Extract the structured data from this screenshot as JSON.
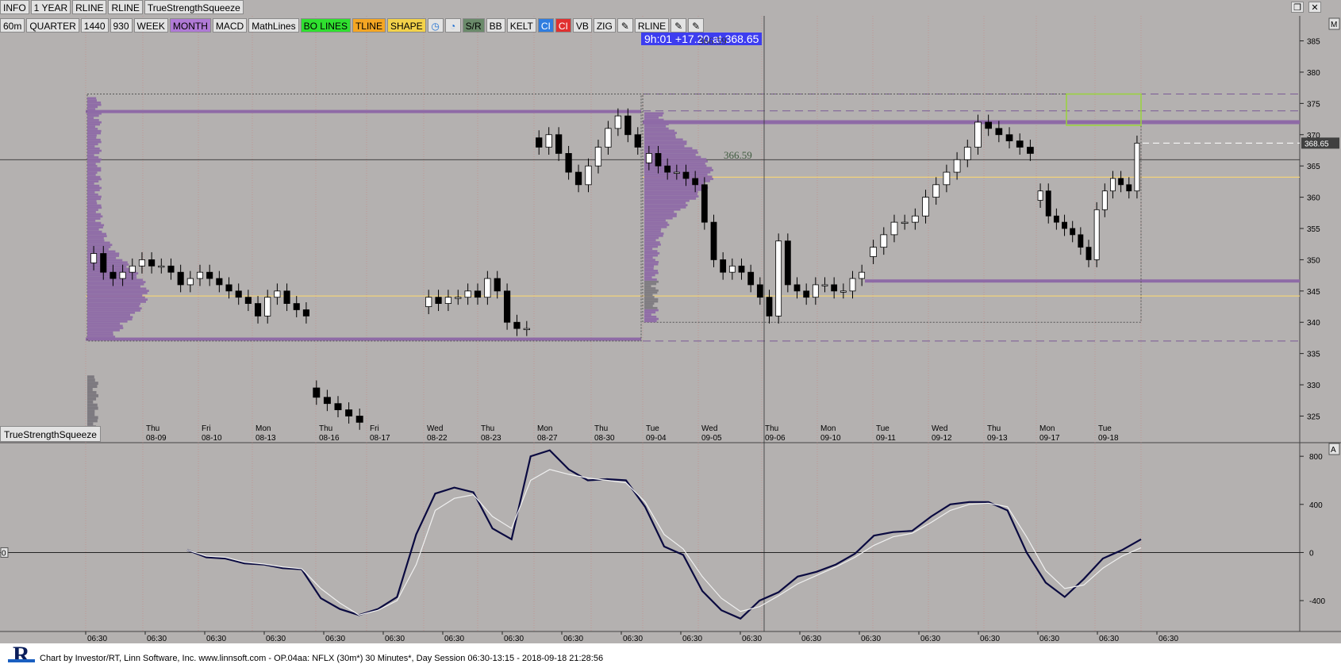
{
  "toolbar_row1": [
    "INFO",
    "1 YEAR",
    "RLINE",
    "RLINE",
    "TrueStrengthSqueeze"
  ],
  "toolbar_row2": [
    {
      "label": "60m",
      "color": "#e3e3e3"
    },
    {
      "label": "QUARTER",
      "color": "#e3e3e3"
    },
    {
      "label": "1440",
      "color": "#e3e3e3"
    },
    {
      "label": "930",
      "color": "#e3e3e3"
    },
    {
      "label": "WEEK",
      "color": "#e3e3e3"
    },
    {
      "label": "MONTH",
      "color": "#b07ad6"
    },
    {
      "label": "MACD",
      "color": "#e3e3e3"
    },
    {
      "label": "MathLines",
      "color": "#e3e3e3"
    },
    {
      "label": "BO LINES",
      "color": "#2fe02f"
    },
    {
      "label": "TLINE",
      "color": "#f5a623"
    },
    {
      "label": "SHAPE",
      "color": "#f3d24a"
    },
    {
      "icon": "clock-icon",
      "glyph": "◷",
      "color": "#e3e3e3"
    },
    {
      "icon": "stopwatch-icon",
      "glyph": "◔",
      "color": "#e3e3e3"
    },
    {
      "label": "S/R",
      "color": "#6a8a6a"
    },
    {
      "label": "BB",
      "color": "#e3e3e3"
    },
    {
      "label": "KELT",
      "color": "#e3e3e3"
    },
    {
      "label": "CI",
      "color": "#2f7de0"
    },
    {
      "label": "CI",
      "color": "#e03030"
    },
    {
      "label": "VB",
      "color": "#e3e3e3"
    },
    {
      "label": "ZIG",
      "color": "#e3e3e3"
    },
    {
      "icon": "pencil-icon",
      "glyph": "✎",
      "color": "#e3e3e3"
    },
    {
      "label": "RLINE",
      "color": "#e3e3e3"
    },
    {
      "icon": "pencil-icon",
      "glyph": "✎",
      "color": "#e3e3e3"
    },
    {
      "icon": "pencil-icon",
      "glyph": "✎",
      "color": "#e3e3e3"
    }
  ],
  "price_info": "9h:01  +17.20 at 368.65",
  "price_info_overlay": "366.59",
  "vpoc_label": "366.59",
  "indicator_label": "TrueStrengthSqueeze",
  "last_price_tag": "368.65",
  "zero_marker": "0",
  "right_markers": {
    "main": "M",
    "indicator": "A"
  },
  "footer_text": "Chart by Investor/RT, Linn Software, Inc. www.linnsoft.com - OP.04aa: NFLX (30m*) 30 Minutes*, Day Session 06:30-13:15 - 2018-09-18 21:28:56",
  "chart_data": [
    {
      "type": "candlestick",
      "title": "NFLX (30m*) 30 Minutes*",
      "ylim": [
        321,
        389
      ],
      "y_ticks": [
        325,
        330,
        335,
        340,
        345,
        350,
        355,
        360,
        365,
        370,
        375,
        380,
        385
      ],
      "day_labels": [
        {
          "day": "Thu",
          "date": "08-09"
        },
        {
          "day": "Fri",
          "date": "08-10"
        },
        {
          "day": "Mon",
          "date": "08-13"
        },
        {
          "day": "Thu",
          "date": "08-16"
        },
        {
          "day": "Fri",
          "date": "08-17"
        },
        {
          "day": "Wed",
          "date": "08-22"
        },
        {
          "day": "Thu",
          "date": "08-23"
        },
        {
          "day": "Mon",
          "date": "08-27"
        },
        {
          "day": "Thu",
          "date": "08-30"
        },
        {
          "day": "Tue",
          "date": "09-04"
        },
        {
          "day": "Wed",
          "date": "09-05"
        },
        {
          "day": "Thu",
          "date": "09-06"
        },
        {
          "day": "Mon",
          "date": "09-10"
        },
        {
          "day": "Tue",
          "date": "09-11"
        },
        {
          "day": "Wed",
          "date": "09-12"
        },
        {
          "day": "Thu",
          "date": "09-13"
        },
        {
          "day": "Mon",
          "date": "09-17"
        },
        {
          "day": "Tue",
          "date": "09-18"
        }
      ],
      "closes": [
        351,
        348,
        347,
        348,
        349,
        350,
        349,
        349,
        348,
        346,
        347,
        348,
        347,
        346,
        345,
        344,
        343,
        341,
        344,
        345,
        343,
        342,
        341,
        328,
        327,
        326,
        325,
        324,
        344,
        343,
        344,
        344,
        345,
        344,
        347,
        345,
        340,
        339,
        339,
        368,
        370,
        367,
        364,
        362,
        365,
        368,
        371,
        373,
        370,
        368,
        367,
        365,
        364,
        364,
        363,
        362,
        356,
        350,
        348,
        349,
        348,
        346,
        344,
        341,
        353,
        346,
        345,
        344,
        346,
        346,
        345,
        345,
        347,
        348,
        352,
        354,
        356,
        356,
        357,
        360,
        362,
        364,
        366,
        368,
        372,
        371,
        370,
        369,
        368,
        367,
        361,
        357,
        356,
        355,
        354,
        352,
        350,
        358,
        361,
        363,
        362,
        361,
        368.65
      ],
      "reference_lines": {
        "value_area_high_aug": 373.7,
        "poc_aug": 344.2,
        "value_area_low_aug": 337.3,
        "value_area_high_sep": 372.0,
        "poc_sep": 363.2,
        "value_area_low_sep": 346.6,
        "dashed_upper": 376.5,
        "dashed_mid": 373.8,
        "dashed_lower": 337.0,
        "current": 366.0
      }
    },
    {
      "type": "line",
      "title": "TrueStrengthSqueeze",
      "ylim": [
        -650,
        900
      ],
      "y_ticks": [
        -400,
        0,
        400,
        800
      ],
      "x_labels": [
        "06:30",
        "06:30",
        "06:30",
        "06:30",
        "06:30",
        "06:30",
        "06:30",
        "06:30",
        "06:30",
        "06:30",
        "06:30",
        "06:30",
        "06:30",
        "06:30",
        "06:30",
        "06:30",
        "06:30",
        "06:30",
        "06:30"
      ],
      "series": [
        {
          "color": "#0a0a40",
          "values": [
            20,
            -40,
            -50,
            -90,
            -100,
            -130,
            -140,
            -380,
            -470,
            -520,
            -470,
            -370,
            150,
            490,
            540,
            500,
            200,
            110,
            800,
            850,
            690,
            600,
            610,
            600,
            380,
            50,
            -20,
            -320,
            -480,
            -550,
            -400,
            -330,
            -200,
            -160,
            -100,
            -10,
            140,
            170,
            180,
            300,
            400,
            420,
            420,
            350,
            0,
            -250,
            -370,
            -220,
            -50,
            20,
            110
          ]
        },
        {
          "color": "#f0f0f0",
          "values": [
            20,
            -30,
            -40,
            -80,
            -95,
            -120,
            -135,
            -300,
            -420,
            -520,
            -480,
            -400,
            -100,
            350,
            450,
            480,
            300,
            200,
            600,
            690,
            650,
            620,
            600,
            580,
            420,
            150,
            30,
            -200,
            -380,
            -490,
            -450,
            -360,
            -260,
            -190,
            -120,
            -40,
            60,
            130,
            160,
            250,
            350,
            400,
            410,
            380,
            130,
            -150,
            -300,
            -270,
            -130,
            -30,
            40
          ]
        }
      ]
    }
  ]
}
